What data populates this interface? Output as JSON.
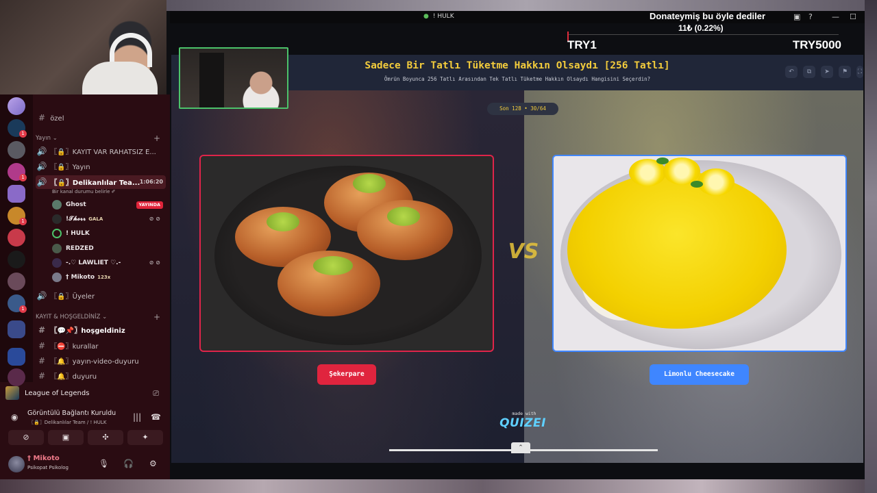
{
  "window": {
    "tab_title": "! HULK"
  },
  "donation": {
    "title": "Donateymiş bu öyle dediler",
    "amount": "11₺ (0.22%)",
    "progress_percent": 0.22,
    "min_label": "TRY1",
    "max_label": "TRY5000",
    "fill_color": "#e02c3c"
  },
  "discord": {
    "channels": [
      {
        "icon": "#",
        "label": "özel"
      },
      {
        "category": "Yayın"
      },
      {
        "icon": "speaker",
        "label": "〖🔒〗KAYIT VAR RAHATSIZ E..."
      },
      {
        "icon": "speaker",
        "label": "〖🔒〗Yayın"
      },
      {
        "icon": "speaker",
        "label": "〖🔒〗Delikanlılar Tea...",
        "timer": "1:06:20",
        "note": "Bir kanal durumu belirle ✐"
      }
    ],
    "members": [
      {
        "name": "Ghost",
        "badge": "YAYINDA"
      },
      {
        "name": "!𝓣𝓱𝓸𝓻𝓻",
        "tag": "GALA"
      },
      {
        "name": "! HULK"
      },
      {
        "name": "REDZED"
      },
      {
        "name": "-.♡ LAWLIET ♡.-"
      },
      {
        "name": "† Mikoto",
        "tag": "123x"
      }
    ],
    "channels_after": [
      {
        "icon": "speaker",
        "label": "〖🔒〗Üyeler"
      },
      {
        "category": "KAYIT & HOŞGELDİNİZ"
      },
      {
        "icon": "#",
        "label": "〖💬📌〗hoşgeldiniz"
      },
      {
        "icon": "#",
        "label": "〖⛔〗kurallar"
      },
      {
        "icon": "#",
        "label": "〖🔔〗yayın-video-duyuru"
      },
      {
        "icon": "#",
        "label": "〖🔔〗duyuru"
      }
    ],
    "activity": "League of Legends",
    "voice_status": "Görüntülü Bağlantı Kuruldu",
    "voice_channel": "〖🔒〗Delikanlılar Team / ! HULK",
    "user": {
      "name": "† Mikoto",
      "status": "Psikopat Psikolog"
    },
    "accent": "#2a0c12"
  },
  "quiz": {
    "title": "Sadece Bir Tatlı Tüketme Hakkın Olsaydı [256 Tatlı]",
    "subtitle": "Ömrün Boyunca 256 Tatlı Arasından Tek Tatlı Tüketme Hakkın Olsaydı Hangisini Seçerdin?",
    "round": "Son 128 • 30/64",
    "vs": "VS",
    "left_choice": "Şekerpare",
    "right_choice": "Limonlu Cheesecake",
    "made_with": "made with",
    "brand": "QUIZEI",
    "title_color": "#f3cc3c",
    "left_color": "#e0243e",
    "right_color": "#3f86ff"
  }
}
